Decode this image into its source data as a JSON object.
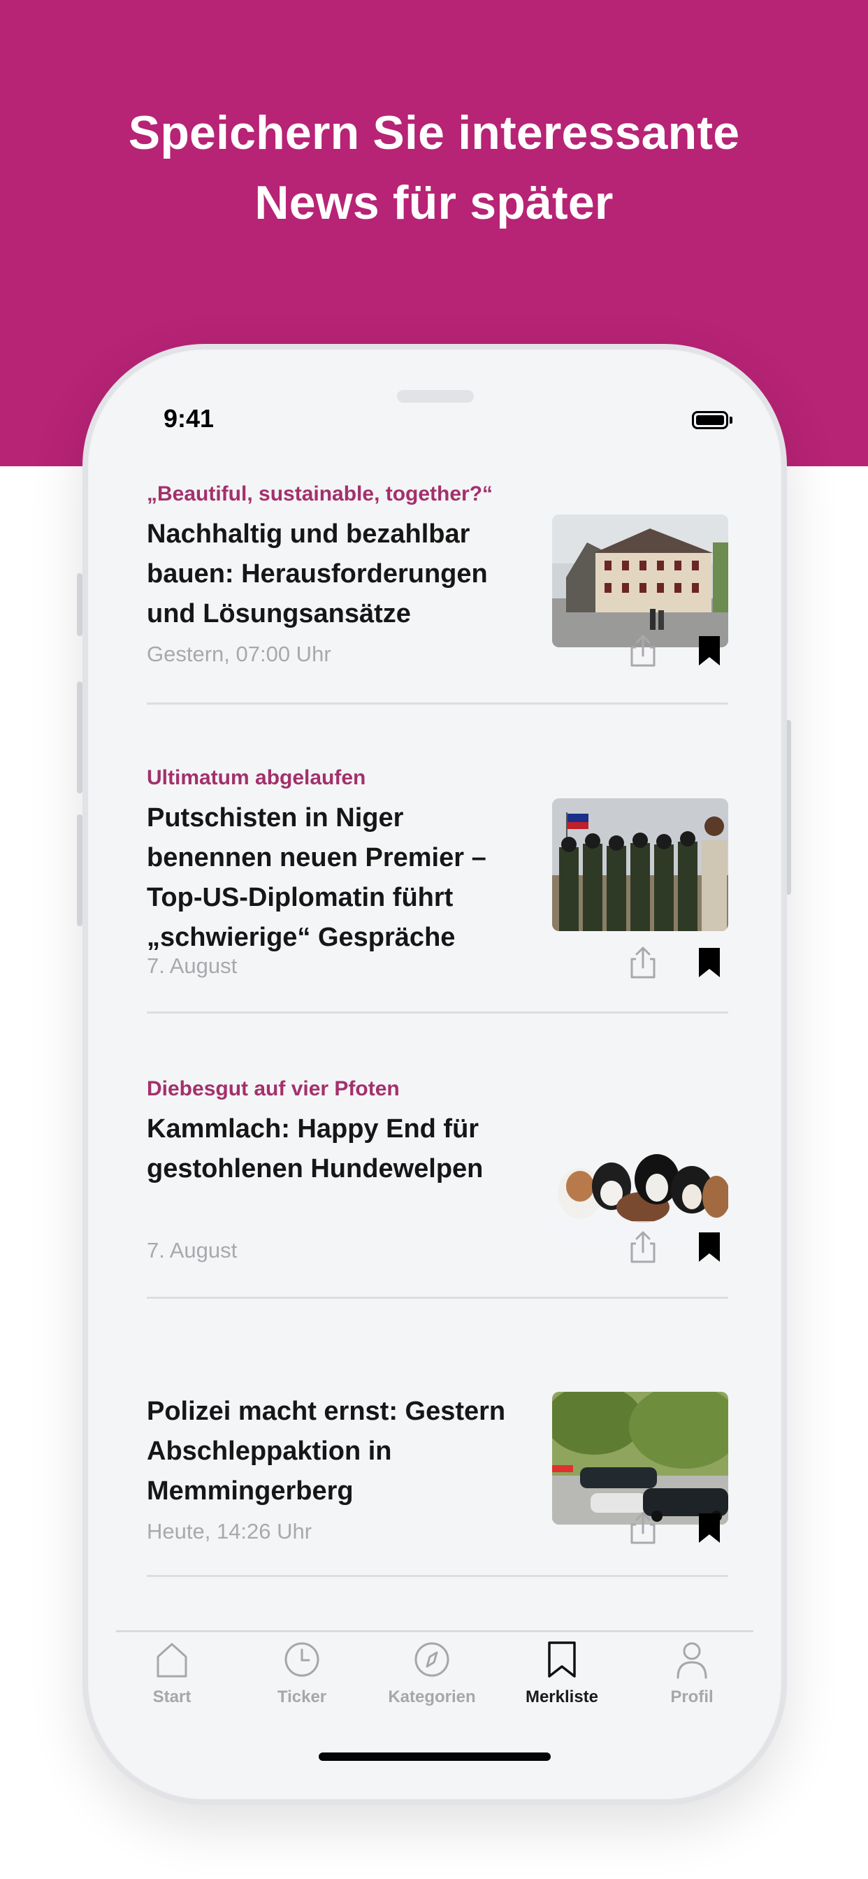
{
  "promo": {
    "headline": "Speichern Sie interessante\nNews für später",
    "background_color": "#b72375"
  },
  "status_bar": {
    "time": "9:41"
  },
  "articles": [
    {
      "kicker": "„Beautiful, sustainable, together?“",
      "title": "Nachhaltig und bezahlbar bauen: Herausforderungen und Lösungsansätze",
      "date": "Gestern, 07:00 Uhr",
      "image": "house-photo",
      "bookmarked": true
    },
    {
      "kicker": "Ultimatum abgelaufen",
      "title": "Putschisten in Niger benennen neuen Premier – Top-US-Diplomatin führt „schwierige“ Gespräche",
      "date": "7. August",
      "image": "soldiers-photo",
      "bookmarked": true
    },
    {
      "kicker": "Diebesgut auf vier Pfoten",
      "title": "Kammlach: Happy End für gestohlenen Hundewelpen",
      "date": "7. August",
      "image": "puppies-photo",
      "bookmarked": true
    },
    {
      "kicker": "",
      "title": "Polizei macht ernst: Gestern Abschleppaktion in Memmingerberg",
      "date": "Heute, 14:26 Uhr",
      "image": "cars-photo",
      "bookmarked": true
    }
  ],
  "tabbar": {
    "active": "Merkliste",
    "tabs": [
      {
        "label": "Start",
        "icon": "home-icon"
      },
      {
        "label": "Ticker",
        "icon": "clock-icon"
      },
      {
        "label": "Kategorien",
        "icon": "compass-icon"
      },
      {
        "label": "Merkliste",
        "icon": "bookmark-icon"
      },
      {
        "label": "Profil",
        "icon": "person-icon"
      }
    ]
  },
  "colors": {
    "accent": "#b72375",
    "kicker": "#a3306b",
    "date_gray": "#a9a9ad",
    "screen_bg": "#f4f5f7"
  }
}
